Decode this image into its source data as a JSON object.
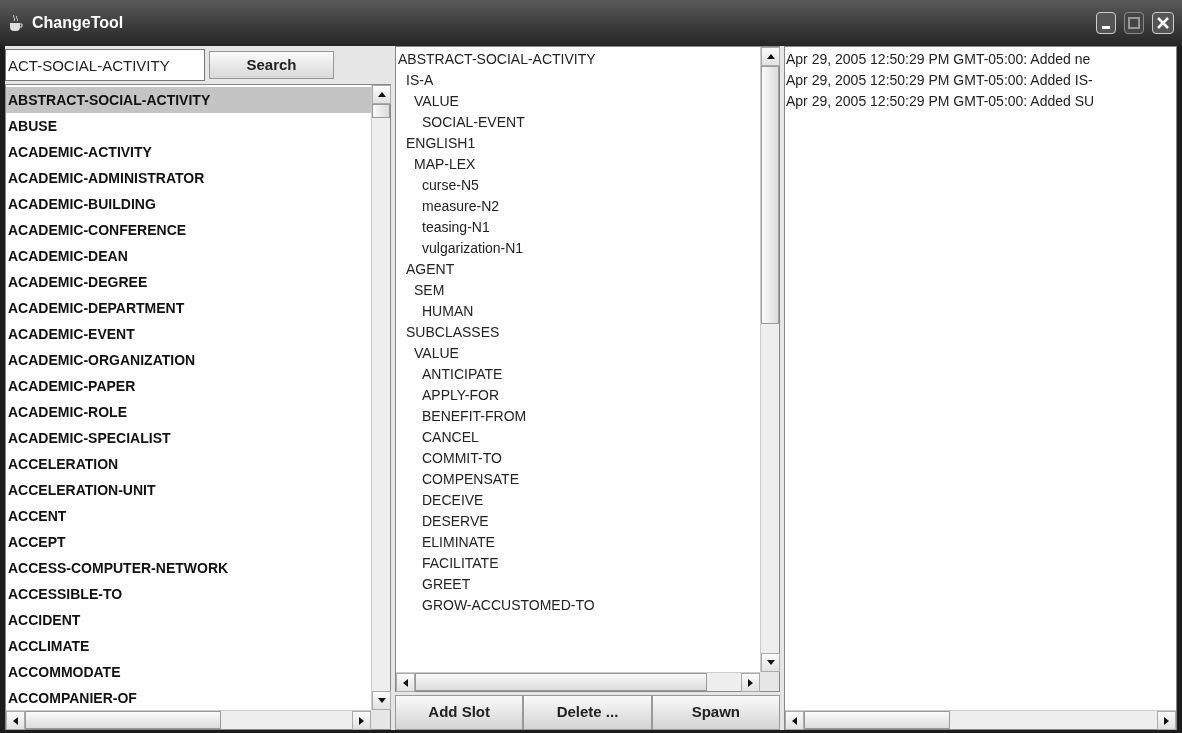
{
  "window": {
    "title": "ChangeTool"
  },
  "search": {
    "value": "ACT-SOCIAL-ACTIVITY",
    "button": "Search"
  },
  "concepts": [
    {
      "label": "ABSTRACT-SOCIAL-ACTIVITY",
      "selected": true
    },
    {
      "label": "ABUSE",
      "selected": false
    },
    {
      "label": "ACADEMIC-ACTIVITY",
      "selected": false
    },
    {
      "label": "ACADEMIC-ADMINISTRATOR",
      "selected": false
    },
    {
      "label": "ACADEMIC-BUILDING",
      "selected": false
    },
    {
      "label": "ACADEMIC-CONFERENCE",
      "selected": false
    },
    {
      "label": "ACADEMIC-DEAN",
      "selected": false
    },
    {
      "label": "ACADEMIC-DEGREE",
      "selected": false
    },
    {
      "label": "ACADEMIC-DEPARTMENT",
      "selected": false
    },
    {
      "label": "ACADEMIC-EVENT",
      "selected": false
    },
    {
      "label": "ACADEMIC-ORGANIZATION",
      "selected": false
    },
    {
      "label": "ACADEMIC-PAPER",
      "selected": false
    },
    {
      "label": "ACADEMIC-ROLE",
      "selected": false
    },
    {
      "label": "ACADEMIC-SPECIALIST",
      "selected": false
    },
    {
      "label": "ACCELERATION",
      "selected": false
    },
    {
      "label": "ACCELERATION-UNIT",
      "selected": false
    },
    {
      "label": "ACCENT",
      "selected": false
    },
    {
      "label": "ACCEPT",
      "selected": false
    },
    {
      "label": "ACCESS-COMPUTER-NETWORK",
      "selected": false
    },
    {
      "label": "ACCESSIBLE-TO",
      "selected": false
    },
    {
      "label": "ACCIDENT",
      "selected": false
    },
    {
      "label": "ACCLIMATE",
      "selected": false
    },
    {
      "label": "ACCOMMODATE",
      "selected": false
    },
    {
      "label": "ACCOMPANIER-OF",
      "selected": false
    }
  ],
  "frame_tree": [
    {
      "label": "ABSTRACT-SOCIAL-ACTIVITY",
      "children": [
        {
          "label": "IS-A",
          "children": [
            {
              "label": "VALUE",
              "children": [
                {
                  "label": "SOCIAL-EVENT"
                }
              ]
            }
          ]
        },
        {
          "label": "ENGLISH1",
          "children": [
            {
              "label": "MAP-LEX",
              "children": [
                {
                  "label": "curse-N5"
                },
                {
                  "label": "measure-N2"
                },
                {
                  "label": "teasing-N1"
                },
                {
                  "label": "vulgarization-N1"
                }
              ]
            }
          ]
        },
        {
          "label": "AGENT",
          "children": [
            {
              "label": "SEM",
              "children": [
                {
                  "label": "HUMAN"
                }
              ]
            }
          ]
        },
        {
          "label": "SUBCLASSES",
          "children": [
            {
              "label": "VALUE",
              "children": [
                {
                  "label": "ANTICIPATE"
                },
                {
                  "label": "APPLY-FOR"
                },
                {
                  "label": "BENEFIT-FROM"
                },
                {
                  "label": "CANCEL"
                },
                {
                  "label": "COMMIT-TO"
                },
                {
                  "label": "COMPENSATE"
                },
                {
                  "label": "DECEIVE"
                },
                {
                  "label": "DESERVE"
                },
                {
                  "label": "ELIMINATE"
                },
                {
                  "label": "FACILITATE"
                },
                {
                  "label": "GREET"
                },
                {
                  "label": "GROW-ACCUSTOMED-TO"
                }
              ]
            }
          ]
        }
      ]
    }
  ],
  "actions": [
    "Add Slot",
    "Delete ...",
    "Spawn"
  ],
  "log": [
    "Apr 29, 2005 12:50:29 PM GMT-05:00: Added ne",
    "Apr 29, 2005 12:50:29 PM GMT-05:00: Added IS-",
    "Apr 29, 2005 12:50:29 PM GMT-05:00: Added SU"
  ]
}
